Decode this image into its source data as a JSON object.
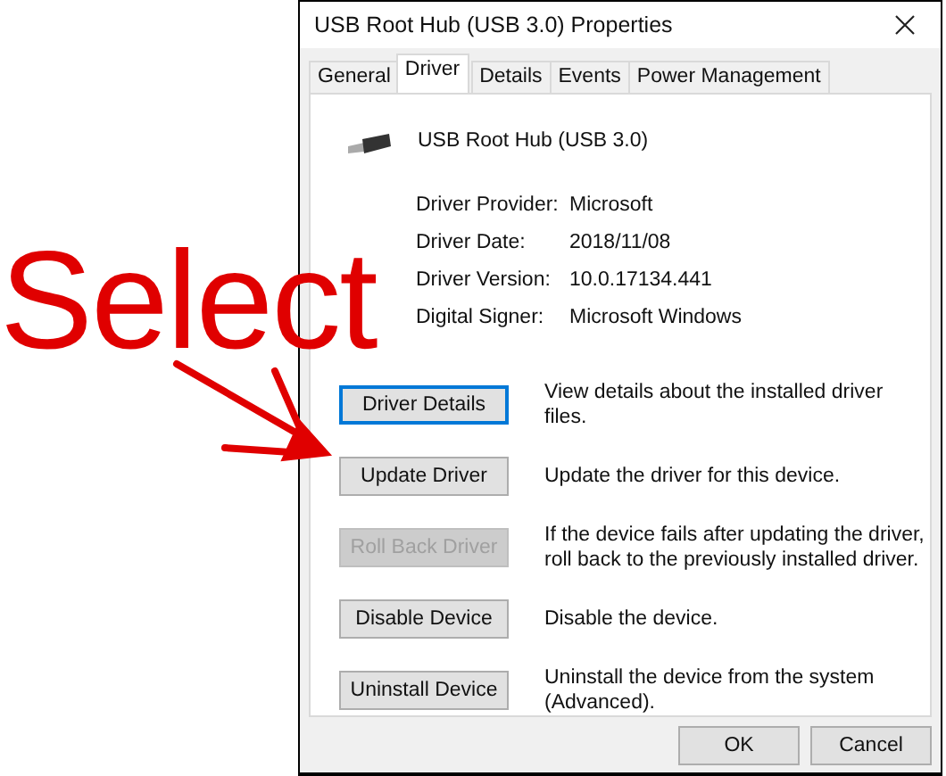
{
  "window": {
    "title": "USB Root Hub (USB 3.0) Properties"
  },
  "tabs": [
    {
      "label": "General",
      "selected": false
    },
    {
      "label": "Driver",
      "selected": true
    },
    {
      "label": "Details",
      "selected": false
    },
    {
      "label": "Events",
      "selected": false
    },
    {
      "label": "Power Management",
      "selected": false
    }
  ],
  "device": {
    "name": "USB Root Hub (USB 3.0)"
  },
  "properties": [
    {
      "label": "Driver Provider:",
      "value": "Microsoft"
    },
    {
      "label": "Driver Date:",
      "value": "2018/11/08"
    },
    {
      "label": "Driver Version:",
      "value": "10.0.17134.441"
    },
    {
      "label": "Digital Signer:",
      "value": "Microsoft Windows"
    }
  ],
  "actions": [
    {
      "button": "Driver Details",
      "description": "View details about the installed driver files.",
      "disabled": false,
      "focused": true
    },
    {
      "button": "Update Driver",
      "description": "Update the driver for this device.",
      "disabled": false,
      "focused": false
    },
    {
      "button": "Roll Back Driver",
      "description": "If the device fails after updating the driver, roll back to the previously installed driver.",
      "disabled": true,
      "focused": false
    },
    {
      "button": "Disable Device",
      "description": "Disable the device.",
      "disabled": false,
      "focused": false
    },
    {
      "button": "Uninstall Device",
      "description": "Uninstall the device from the system (Advanced).",
      "disabled": false,
      "focused": false
    }
  ],
  "footer_buttons": [
    "OK",
    "Cancel"
  ],
  "annotation": {
    "text": "Select"
  }
}
